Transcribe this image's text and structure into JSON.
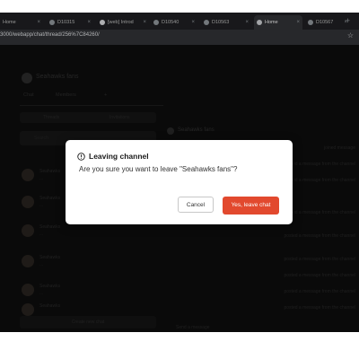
{
  "browser": {
    "tabs": [
      {
        "label": "Home",
        "active": false
      },
      {
        "label": "D10315",
        "active": false
      },
      {
        "label": "[web] Introd",
        "active": false
      },
      {
        "label": "D10540",
        "active": false
      },
      {
        "label": "D10563",
        "active": false
      },
      {
        "label": "Home",
        "active": true
      },
      {
        "label": "D10567",
        "active": false
      }
    ],
    "url": "3000/webapp/chat/thread/256%7C84260/"
  },
  "app": {
    "group_name": "Seahawks fans",
    "tab_chat": "Chat",
    "tab_members": "Members",
    "seg_threads": "Threads",
    "seg_invitations": "Invitations",
    "search_placeholder": "Search",
    "threads": [
      {
        "title": "Seahawks",
        "preview": "..."
      },
      {
        "title": "Seahawks",
        "preview": "..."
      },
      {
        "title": "Seahawks",
        "preview": "..."
      },
      {
        "title": "Seahawks",
        "preview": "..."
      },
      {
        "title": "Seahawks",
        "preview": "..."
      },
      {
        "title": "Seahawks",
        "preview": "..."
      }
    ],
    "create_button": "Create new chat",
    "chat_title": "Seahawks fans",
    "messages": [
      "joined message",
      "posted a message from the channel",
      "posted a message from the channel",
      "posted a message from the channel",
      "posted a message from the channel",
      "posted a message from the channel",
      "posted a message from the channel",
      "posted a message from the channel",
      "posted a message from the channel"
    ],
    "composer_placeholder": "Send a message"
  },
  "modal": {
    "title": "Leaving channel",
    "body": "Are you sure you want to leave \"Seahawks fans\"?",
    "cancel_label": "Cancel",
    "confirm_label": "Yes, leave chat",
    "confirm_color": "#e2492e",
    "icon": "info-circle-icon"
  }
}
